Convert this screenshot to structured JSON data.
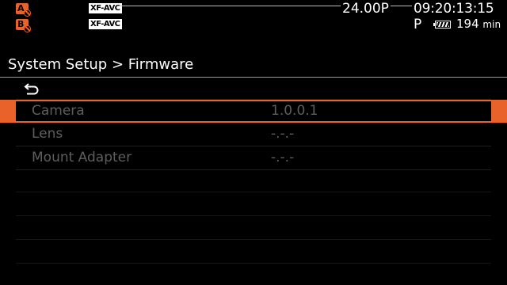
{
  "status_bar": {
    "slot_a": {
      "letter": "A",
      "icon": "card-slot-a-prohibited-icon",
      "color": "#e8622a"
    },
    "slot_b": {
      "letter": "B",
      "icon": "card-slot-b-prohibited-icon",
      "color": "#e8622a"
    },
    "format_a": "XF-AVC",
    "format_b": "XF-AVC",
    "frame_rate": "24.00P",
    "timecode": "09:20:13:15 P",
    "battery_icon": "battery-icon",
    "battery_remaining": "194",
    "battery_unit": "min"
  },
  "menu": {
    "title": "System Setup > Firmware",
    "back_icon": "return-arrow-icon",
    "accent_color": "#e8622a",
    "items": [
      {
        "label": "Camera",
        "value": "1.0.0.1",
        "selected": true
      },
      {
        "label": "Lens",
        "value": "-.-.-",
        "selected": false
      },
      {
        "label": "Mount Adapter",
        "value": "-.-.-",
        "selected": false
      }
    ]
  }
}
